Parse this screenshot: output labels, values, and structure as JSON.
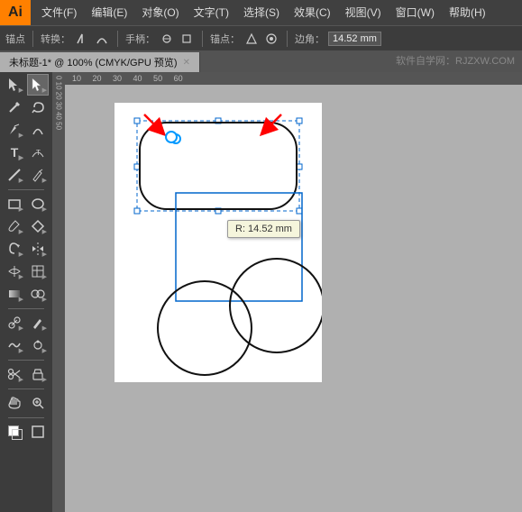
{
  "app": {
    "logo": "Ai",
    "title": "Adobe Illustrator"
  },
  "menubar": {
    "items": [
      "文件(F)",
      "编辑(E)",
      "对象(O)",
      "文字(T)",
      "选择(S)",
      "效果(C)",
      "视图(V)",
      "窗口(W)",
      "帮助(H)"
    ]
  },
  "toolbar": {
    "sections": [
      {
        "label": "锚点"
      },
      {
        "label": "转换："
      },
      {
        "label": "手柄："
      },
      {
        "label": "锚点："
      },
      {
        "label": "边角："
      }
    ],
    "corner_value": "14.52 mm"
  },
  "tabbar": {
    "tab_label": "未标题-1* @ 100% (CMYK/GPU 预览)",
    "watermark": "软件自学网：RJZXW.COM"
  },
  "canvas": {
    "tooltip_label": "R: 14.52 mm"
  },
  "tools": [
    {
      "icon": "↖",
      "name": "selection-tool"
    },
    {
      "icon": "↘",
      "name": "direct-selection-tool"
    },
    {
      "icon": "✒",
      "name": "pen-tool"
    },
    {
      "icon": "T",
      "name": "type-tool"
    },
    {
      "icon": "↩",
      "name": "undo-tool"
    },
    {
      "icon": "✏",
      "name": "pencil-tool"
    },
    {
      "icon": "◻",
      "name": "rectangle-tool"
    },
    {
      "icon": "⬡",
      "name": "polygon-tool"
    },
    {
      "icon": "⟳",
      "name": "rotate-tool"
    },
    {
      "icon": "⊞",
      "name": "grid-tool"
    },
    {
      "icon": "◎",
      "name": "blend-tool"
    },
    {
      "icon": "∿",
      "name": "warp-tool"
    },
    {
      "icon": "✂",
      "name": "scissors-tool"
    },
    {
      "icon": "⊕",
      "name": "zoom-tool"
    },
    {
      "icon": "☰",
      "name": "layers-tool"
    },
    {
      "icon": "⬛",
      "name": "fill-tool"
    }
  ]
}
